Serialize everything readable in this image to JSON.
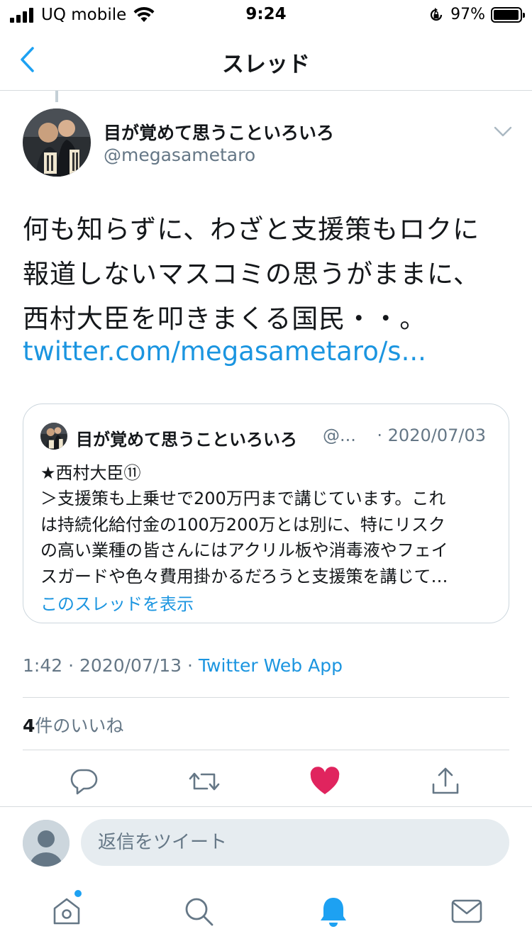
{
  "status_bar": {
    "carrier": "UQ mobile",
    "time": "9:24",
    "battery_percent": "97%",
    "battery_level": 0.97
  },
  "nav": {
    "title": "スレッド",
    "back_icon": "chevron-left-icon"
  },
  "tweet": {
    "display_name": "目が覚めて思うこといろいろ",
    "handle": "@megasametaro",
    "text_lines": [
      "何も知らずに、わざと支援策もロクに",
      "報道しないマスコミの思うがままに、",
      "西村大臣を叩きまくる国民・・。"
    ],
    "link": "twitter.com/megasametaro/s...",
    "time": "1:42",
    "date": "2020/07/13",
    "source_app": "Twitter Web App",
    "separator": " · ",
    "likes_count": "4",
    "likes_label": "件のいいね"
  },
  "quoted_tweet": {
    "display_name": "目が覚めて思うこといろいろ",
    "handle": "@...",
    "date": "· 2020/07/03",
    "body_lines": [
      "★西村大臣⑪",
      "＞支援策も上乗せで200万円まで講じています。これ",
      "は持続化給付金の100万200万とは別に、特にリスク",
      "の高い業種の皆さんにはアクリル板や消毒液やフェイ",
      "スガードや色々費用掛かるだろうと支援策を講じて…"
    ],
    "show_thread": "このスレッドを表示"
  },
  "actions": {
    "reply_icon": "reply-icon",
    "retweet_icon": "retweet-icon",
    "like_icon": "heart-icon",
    "share_icon": "share-icon",
    "liked": true,
    "like_color": "#e0245e"
  },
  "reply_bar": {
    "placeholder": "返信をツイート"
  },
  "tab_bar": {
    "items": [
      "home-icon",
      "search-icon",
      "notifications-icon",
      "messages-icon"
    ],
    "active": "notifications-icon",
    "accent": "#1da1f2"
  }
}
